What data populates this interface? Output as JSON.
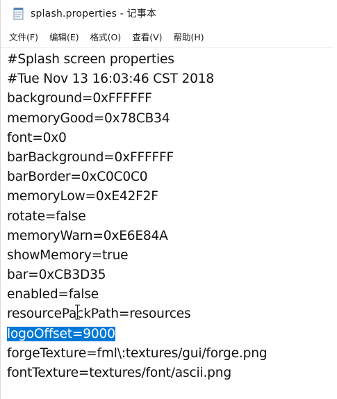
{
  "window": {
    "title": "splash.properties - 记事本",
    "app_icon": "notepad-icon"
  },
  "menu": {
    "items": [
      {
        "label": "文件(F)"
      },
      {
        "label": "编辑(E)"
      },
      {
        "label": "格式(O)"
      },
      {
        "label": "查看(V)"
      },
      {
        "label": "帮助(H)"
      }
    ]
  },
  "editor": {
    "lines": [
      "#Splash screen properties",
      "#Tue Nov 13 16:03:46 CST 2018",
      "background=0xFFFFFF",
      "memoryGood=0x78CB34",
      "font=0x0",
      "barBackground=0xFFFFFF",
      "barBorder=0xC0C0C0",
      "memoryLow=0xE42F2F",
      "rotate=false",
      "memoryWarn=0xE6E84A",
      "showMemory=true",
      "bar=0xCB3D35",
      "enabled=false",
      "resourcePackPath=resources",
      "logoOffset=9000",
      "forgeTexture=fml\\:textures/gui/forge.png",
      "fontTexture=textures/font/ascii.png"
    ],
    "selected_line_index": 14,
    "selection_color": "#0078d7",
    "cursor_icon": "text-cursor-icon"
  }
}
